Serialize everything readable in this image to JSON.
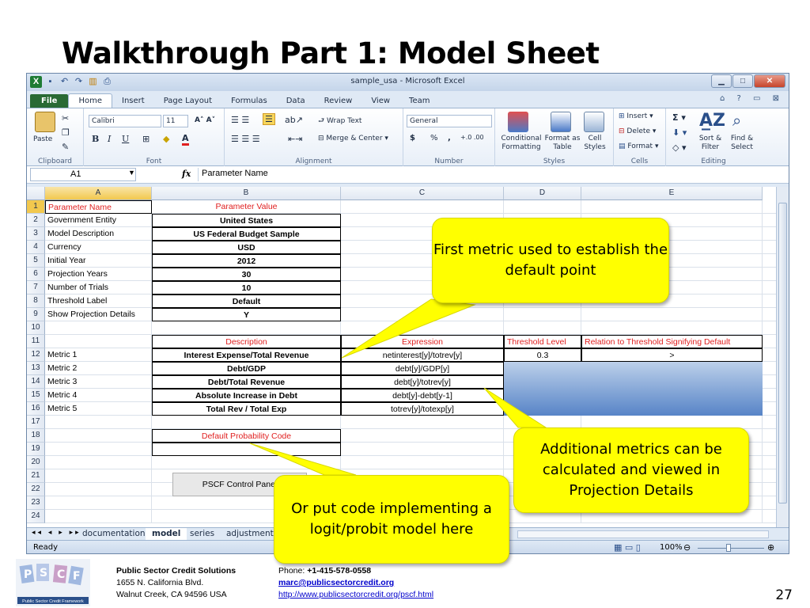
{
  "slide": {
    "title": "Walkthrough Part 1: Model Sheet",
    "page_number": "27"
  },
  "window": {
    "title": "sample_usa  -  Microsoft Excel"
  },
  "ribbon": {
    "tabs": [
      "File",
      "Home",
      "Insert",
      "Page Layout",
      "Formulas",
      "Data",
      "Review",
      "View",
      "Team"
    ],
    "active_tab": "Home",
    "groups": [
      "Clipboard",
      "Font",
      "Alignment",
      "Number",
      "Styles",
      "Cells",
      "Editing"
    ],
    "paste": "Paste",
    "font_name": "Calibri",
    "font_size": "11",
    "bold": "B",
    "italic": "I",
    "underline": "U",
    "wrap_text": "Wrap Text",
    "merge_center": "Merge & Center",
    "number_format": "General",
    "currency": "$",
    "percent": "%",
    "comma": ",",
    "conditional_formatting": "Conditional Formatting",
    "format_as_table": "Format as Table",
    "cell_styles": "Cell Styles",
    "insert": "Insert",
    "delete": "Delete",
    "format": "Format",
    "sort_filter": "Sort & Filter",
    "find_select": "Find & Select"
  },
  "formula_bar": {
    "name_box": "A1",
    "fx": "fx",
    "formula": "Parameter Name"
  },
  "columns": [
    "A",
    "B",
    "C",
    "D",
    "E"
  ],
  "rows": [
    "1",
    "2",
    "3",
    "4",
    "5",
    "6",
    "7",
    "8",
    "9",
    "10",
    "11",
    "12",
    "13",
    "14",
    "15",
    "16",
    "17",
    "18",
    "19",
    "20",
    "21",
    "22",
    "23",
    "24"
  ],
  "cells": {
    "A1": "Parameter Name",
    "B1": "Parameter Value",
    "A2": "Government Entity",
    "B2": "United States",
    "A3": "Model Description",
    "B3": "US Federal Budget Sample",
    "A4": "Currency",
    "B4": "USD",
    "A5": "Initial Year",
    "B5": "2012",
    "A6": "Projection Years",
    "B6": "30",
    "A7": "Number of Trials",
    "B7": "10",
    "A8": "Threshold Label",
    "B8": "Default",
    "A9": "Show Projection Details",
    "B9": "Y",
    "B11": "Description",
    "C11": "Expression",
    "D11": "Threshold Level",
    "E11": "Relation to Threshold Signifying Default",
    "A12": "Metric 1",
    "B12": "Interest Expense/Total Revenue",
    "C12": "netinterest[y]/totrev[y]",
    "D12": "0.3",
    "E12": ">",
    "A13": "Metric 2",
    "B13": "Debt/GDP",
    "C13": "debt[y]/GDP[y]",
    "A14": "Metric 3",
    "B14": "Debt/Total Revenue",
    "C14": "debt[y]/totrev[y]",
    "A15": "Metric 4",
    "B15": "Absolute Increase in Debt",
    "C15": "debt[y]-debt[y-1]",
    "A16": "Metric 5",
    "B16": "Total Rev / Total Exp",
    "C16": "totrev[y]/totexp[y]",
    "B18": "Default Probability Code",
    "button": "PSCF Control Panel"
  },
  "sheet_tabs": [
    "documentation",
    "model",
    "series",
    "adjustments"
  ],
  "active_sheet": "model",
  "status": {
    "ready": "Ready",
    "zoom": "100%"
  },
  "callouts": {
    "first_metric": "First metric used to establish the default point",
    "additional_metrics": "Additional metrics can be calculated and viewed in Projection Details",
    "logit_probit": "Or put code implementing a logit/probit model here"
  },
  "footer": {
    "org_name": "Public Sector Credit Solutions",
    "address1": "1655 N. California Blvd.",
    "address2": "Walnut Creek, CA 94596  USA",
    "phone_label": "Phone: ",
    "phone": "+1-415-578-0558",
    "email": "marc@publicsectorcredit.org",
    "url": "http://www.publicsectorcredit.org/pscf.html",
    "logo_letters": [
      "P",
      "S",
      "C",
      "F"
    ],
    "logo_caption": "Public Sector Credit Framework"
  },
  "colors": {
    "callout": "#ffff00",
    "red_text": "#e02020",
    "excel_green": "#1e7b34"
  }
}
